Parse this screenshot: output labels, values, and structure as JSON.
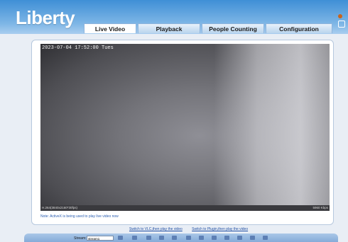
{
  "header": {
    "logo": "Liberty",
    "tabs": [
      {
        "label": "Live Video",
        "active": true
      },
      {
        "label": "Playback",
        "active": false
      },
      {
        "label": "People Counting",
        "active": false
      },
      {
        "label": "Configuration",
        "active": false
      }
    ]
  },
  "video": {
    "timestamp": "2023-07-04 17:52:00 Tues",
    "status_left": "H.264(3840x2160*30fps)",
    "status_right": "5960 Kbps"
  },
  "note": "Note: ActiveX is being used to play live video now",
  "links": {
    "vlc": "Switch to VLC,then play the video",
    "plugin": "Switch to Plugin,then play the video"
  },
  "toolbar": {
    "stream_label": "Stream:",
    "stream_value": "stream1"
  },
  "colors": {
    "header_top": "#3f8fd6",
    "link": "#1f4ea3",
    "note": "#2a5db0"
  }
}
